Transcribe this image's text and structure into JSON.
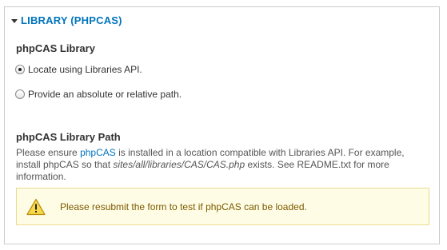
{
  "fieldset": {
    "legend": "LIBRARY (PHPCAS)",
    "library_label": "phpCAS Library",
    "options": [
      {
        "label": "Locate using Libraries API.",
        "checked": true
      },
      {
        "label": "Provide an absolute or relative path.",
        "checked": false
      }
    ],
    "path_label": "phpCAS Library Path",
    "description": {
      "part1": "Please ensure ",
      "link": "phpCAS",
      "part2": " is installed in a location compatible with Libraries API. For example, install phpCAS so that ",
      "path": "sites/all/libraries/CAS/CAS.php",
      "part3": " exists. See README.txt for more information."
    },
    "warning": {
      "icon": "warning-icon",
      "text": "Please resubmit the form to test if phpCAS can be loaded."
    }
  },
  "colors": {
    "legend": "#0074bd",
    "link": "#0074bd",
    "warning_bg": "#fffce5",
    "warning_border": "#eadc90",
    "warning_text": "#7a5a00"
  }
}
